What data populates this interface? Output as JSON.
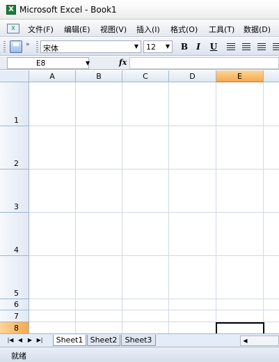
{
  "window": {
    "title": "Microsoft Excel - Book1",
    "app_icon": "X"
  },
  "menu": {
    "doc_icon": "x-icon",
    "items": [
      {
        "label": "文件(F)"
      },
      {
        "label": "编辑(E)"
      },
      {
        "label": "视图(V)"
      },
      {
        "label": "插入(I)"
      },
      {
        "label": "格式(O)"
      },
      {
        "label": "工具(T)"
      },
      {
        "label": "数据(D)"
      }
    ]
  },
  "toolbar": {
    "font_name": "宋体",
    "font_size": "12",
    "bold": "B",
    "italic": "I",
    "underline": "U",
    "more_glyph": "»"
  },
  "formula_bar": {
    "cell_reference": "E8",
    "fx_label": "fx",
    "formula": ""
  },
  "sheet": {
    "columns": [
      "A",
      "B",
      "C",
      "D",
      "E"
    ],
    "rows": [
      "1",
      "2",
      "3",
      "4",
      "5",
      "6",
      "7",
      "8"
    ],
    "active_column": "E",
    "active_row": "8",
    "tabs": [
      {
        "label": "Sheet1",
        "active": true
      },
      {
        "label": "Sheet2",
        "active": false
      },
      {
        "label": "Sheet3",
        "active": false
      }
    ]
  },
  "status": {
    "text": "就绪"
  },
  "colors": {
    "active_header": "#f6a94c",
    "header_border": "#9eb6ce",
    "gridline": "#d0d7e5"
  }
}
